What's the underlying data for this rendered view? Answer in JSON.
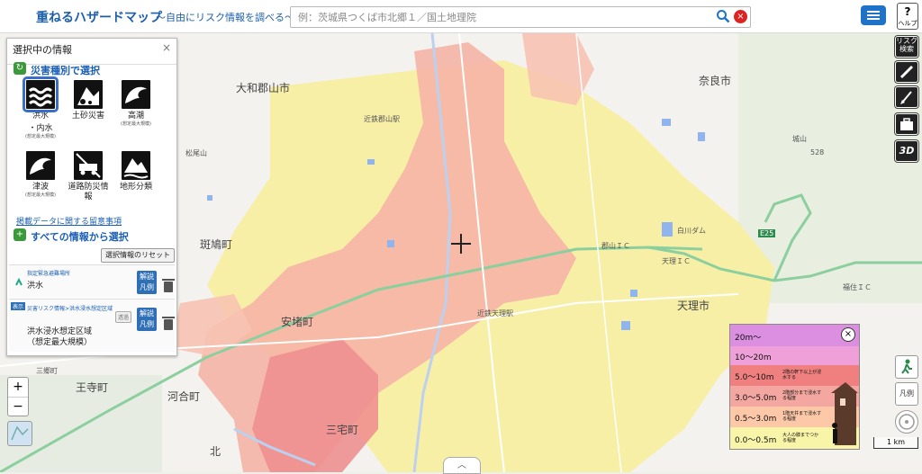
{
  "header": {
    "title": "重ねるハザードマップ",
    "subtitle": "～自由にリスク情報を調べる～",
    "search_placeholder": "例：茨城県つくば市北郷１／国土地理院",
    "clear_label": "×",
    "help_label": "?",
    "help_sub": "ヘルプ"
  },
  "panel": {
    "title": "選択中の情報",
    "close": "×",
    "by_type_title": "災害種別で選択",
    "hazards": [
      {
        "label": "洪水",
        "label2": "・内水",
        "sub": "(想定最大規模)"
      },
      {
        "label": "土砂災害",
        "label2": "",
        "sub": ""
      },
      {
        "label": "高潮",
        "label2": "",
        "sub": "(想定最大規模)"
      },
      {
        "label": "津波",
        "label2": "",
        "sub": "(想定最大規模)"
      },
      {
        "label": "道路防災情報",
        "label2": "",
        "sub": ""
      },
      {
        "label": "地形分類",
        "label2": "",
        "sub": ""
      }
    ],
    "notice_link": "掲載データに関する留意事項",
    "all_info_title": "すべての情報から選択",
    "reset_label": "選択情報のリセット",
    "layer1_path": "指定緊急避難場所",
    "layer1_name": "洪水",
    "layer2_badge": "表示",
    "layer2_path": "災害リスク情報>洪水浸水想定区域",
    "layer2_name": "洪水浸水想定区域",
    "layer2_name2": "（想定最大規模）",
    "opacity_label": "透過",
    "legend_btn": "解説",
    "legend_btn2": "凡例"
  },
  "map_labels": {
    "yamato": "大和郡山市",
    "nara": "奈良市",
    "ikaruga": "斑鳩町",
    "tenri": "天理市",
    "ando": "安堵町",
    "kawai": "河合町",
    "miyake": "三宅町",
    "oji": "王寺町",
    "kita": "北",
    "kinki_koriyama": "近鉄郡山駅",
    "kinki_tenri": "近鉄天理駅",
    "tenri_ic": "天理ＩＣ",
    "fukusumi_ic": "福住ＩＣ",
    "shirakawa": "白川ダム",
    "matsuo": "松尾山",
    "jou": "城山",
    "koriyama_ic": "郡山ＩＣ",
    "e25": "E25",
    "nakashima": "三郷町",
    "elev": "528"
  },
  "tools": {
    "risk": "リスク検索",
    "threed": "3D",
    "hanrei": "凡例"
  },
  "depth_legend": {
    "rows": [
      {
        "range": "20m～",
        "desc": "",
        "color": "#dc8fe0"
      },
      {
        "range": "10～20m",
        "desc": "",
        "color": "#f0a0d8"
      },
      {
        "range": "5.0～10m",
        "desc": "2階の軒下以上が浸水する",
        "color": "#f08080"
      },
      {
        "range": "3.0～5.0m",
        "desc": "2階部分まで浸水する程度",
        "color": "#f4a6a0"
      },
      {
        "range": "0.5～3.0m",
        "desc": "1階天井まで浸水する程度",
        "color": "#fcc8a8"
      },
      {
        "range": "0.0～0.5m",
        "desc": "大人の膝までつかる程度",
        "color": "#f8f4a8"
      }
    ],
    "close": "×"
  },
  "zoom": {
    "in": "+",
    "out": "−"
  },
  "scale": "1 km",
  "drawer": "︿"
}
